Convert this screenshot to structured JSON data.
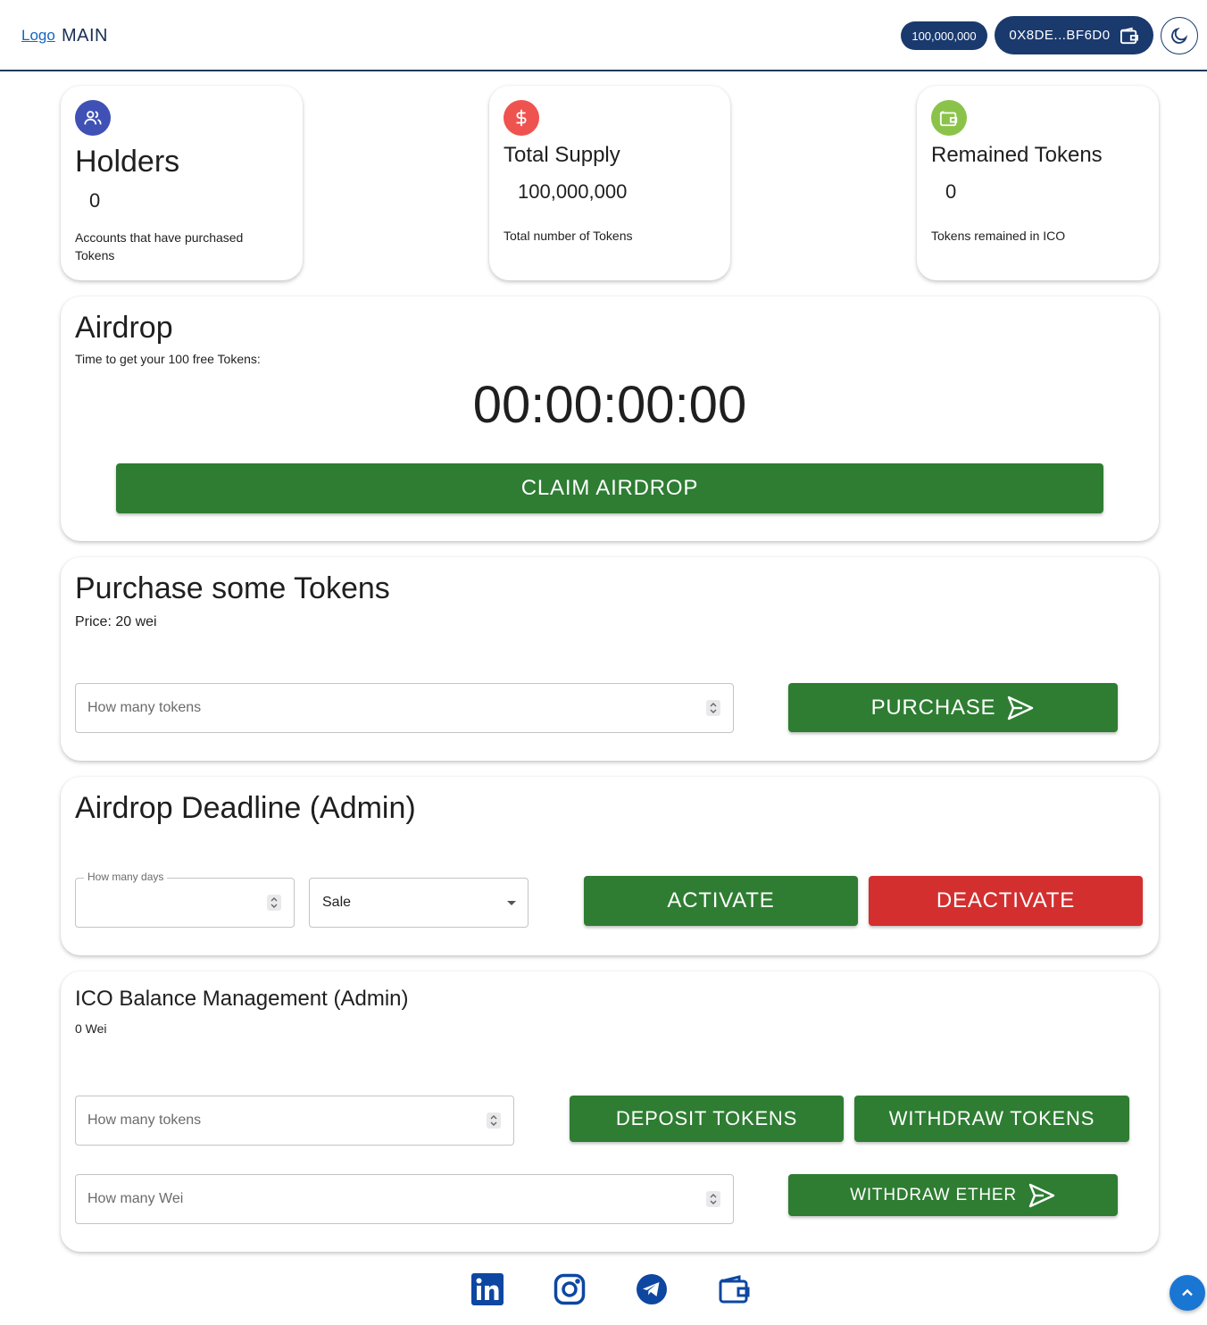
{
  "header": {
    "logo": "Logo",
    "title": "MAIN",
    "balance": "100,000,000",
    "wallet_address": "0X8DE...BF6D0"
  },
  "stats": [
    {
      "icon": "users-icon",
      "color": "#3f51b5",
      "title": "Holders",
      "value": "0",
      "description": "Accounts that have purchased Tokens"
    },
    {
      "icon": "dollar-icon",
      "color": "#ef5350",
      "title": "Total Supply",
      "value": "100,000,000",
      "description": "Total number of Tokens"
    },
    {
      "icon": "wallet-icon",
      "color": "#8bc34a",
      "title": "Remained Tokens",
      "value": "0",
      "description": "Tokens remained in ICO"
    }
  ],
  "airdrop": {
    "title": "Airdrop",
    "subtitle": "Time to get your 100 free Tokens:",
    "countdown": "00:00:00:00",
    "claim_label": "CLAIM AIRDROP"
  },
  "purchase": {
    "title": "Purchase some Tokens",
    "price": "Price: 20 wei",
    "input_placeholder": "How many tokens",
    "button_label": "PURCHASE"
  },
  "deadline": {
    "title": "Airdrop Deadline (Admin)",
    "days_label": "How many days",
    "select_value": "Sale",
    "activate_label": "ACTIVATE",
    "deactivate_label": "DEACTIVATE"
  },
  "balance_mgmt": {
    "title": "ICO Balance Management (Admin)",
    "balance": "0 Wei",
    "tokens_placeholder": "How many tokens",
    "deposit_label": "DEPOSIT TOKENS",
    "withdraw_tokens_label": "WITHDRAW TOKENS",
    "wei_placeholder": "How many Wei",
    "withdraw_ether_label": "WITHDRAW ETHER"
  },
  "footer": {
    "icons": [
      "linkedin-icon",
      "instagram-icon",
      "telegram-icon",
      "wallet-icon"
    ]
  },
  "colors": {
    "primary": "#1a3a6e",
    "success": "#2e7d32",
    "danger": "#d32f2f",
    "link": "#1565c0"
  }
}
